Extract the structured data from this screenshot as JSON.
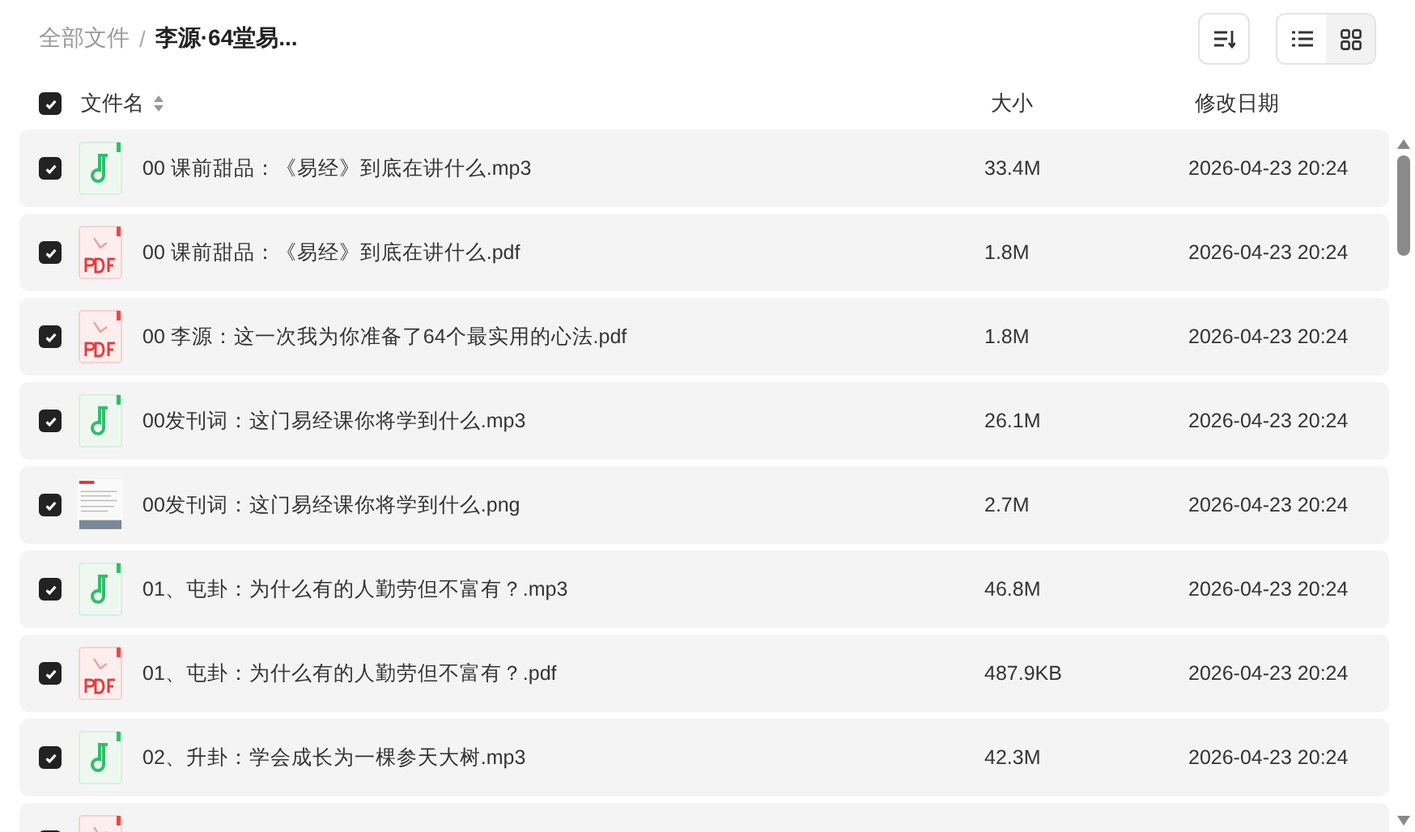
{
  "breadcrumb_separator": "/",
  "breadcrumb": [
    {
      "label": "全部文件",
      "current": false
    },
    {
      "label": "李源·64堂易...",
      "current": true
    }
  ],
  "toolbar": {
    "views": [
      {
        "kind": "list",
        "selected": true
      },
      {
        "kind": "grid",
        "selected": false
      }
    ]
  },
  "header": {
    "all_checked": true,
    "columns": [
      "文件名",
      "大小",
      "修改日期"
    ]
  },
  "files": [
    {
      "kind": "audio",
      "checked": true,
      "name": "00 课前甜品：《易经》到底在讲什么.mp3",
      "size": "33.4M",
      "date": "2026-04-23 20:24"
    },
    {
      "kind": "pdf",
      "checked": true,
      "name": "00 课前甜品：《易经》到底在讲什么.pdf",
      "size": "1.8M",
      "date": "2026-04-23 20:24"
    },
    {
      "kind": "pdf",
      "checked": true,
      "name": "00 李源：这一次我为你准备了64个最实用的心法.pdf",
      "size": "1.8M",
      "date": "2026-04-23 20:24"
    },
    {
      "kind": "audio",
      "checked": true,
      "name": "00发刊词：这门易经课你将学到什么.mp3",
      "size": "26.1M",
      "date": "2026-04-23 20:24"
    },
    {
      "kind": "image",
      "checked": true,
      "name": "00发刊词：这门易经课你将学到什么.png",
      "size": "2.7M",
      "date": "2026-04-23 20:24"
    },
    {
      "kind": "audio",
      "checked": true,
      "name": "01、屯卦：为什么有的人勤劳但不富有？.mp3",
      "size": "46.8M",
      "date": "2026-04-23 20:24"
    },
    {
      "kind": "pdf",
      "checked": true,
      "name": "01、屯卦：为什么有的人勤劳但不富有？.pdf",
      "size": "487.9KB",
      "date": "2026-04-23 20:24"
    },
    {
      "kind": "audio",
      "checked": true,
      "name": "02、升卦：学会成长为一棵参天大树.mp3",
      "size": "42.3M",
      "date": "2026-04-23 20:24"
    },
    {
      "kind": "pdf",
      "checked": true
    }
  ]
}
